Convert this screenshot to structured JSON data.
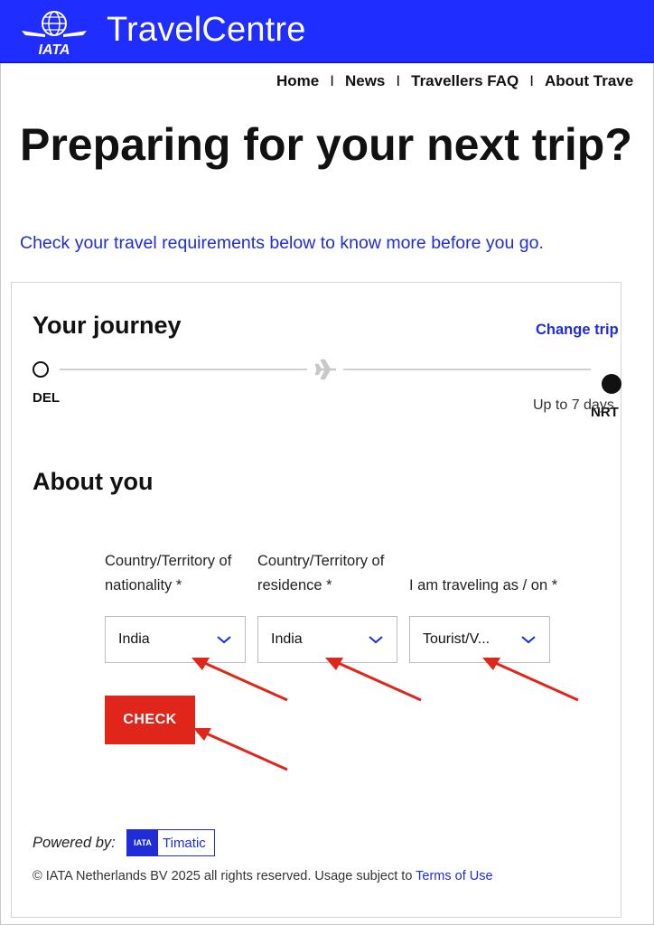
{
  "header": {
    "logo_text": "IATA",
    "brand": "TravelCentre",
    "color": "#1f2dff"
  },
  "nav": {
    "items": [
      "Home",
      "News",
      "Travellers FAQ",
      "About Trave"
    ],
    "separator": "I"
  },
  "hero": {
    "title": "Preparing for your next trip?",
    "subtitle": "Check your travel requirements below to know more before you go."
  },
  "journey": {
    "title": "Your journey",
    "change_link": "Change trip",
    "origin": "DEL",
    "destination": "NRT",
    "duration": "Up to 7 days",
    "icon": "plane-icon"
  },
  "about": {
    "title": "About you",
    "fields": [
      {
        "label_line1": "Country/Territory of",
        "label_line2": "nationality *",
        "value": "India"
      },
      {
        "label_line1": "Country/Territory of",
        "label_line2": "residence *",
        "value": "India"
      },
      {
        "label_line1": "",
        "label_line2": "I am traveling as / on *",
        "value": "Tourist/V..."
      }
    ],
    "check_button": "CHECK",
    "button_color": "#e0261b"
  },
  "powered": {
    "label": "Powered by:",
    "badge_logo": "IATA",
    "badge_text": "Timatic"
  },
  "footer": {
    "text": "© IATA Netherlands BV 2025 all rights reserved. Usage subject to ",
    "link": "Terms of Use"
  },
  "annotation_color": "#e0261b"
}
